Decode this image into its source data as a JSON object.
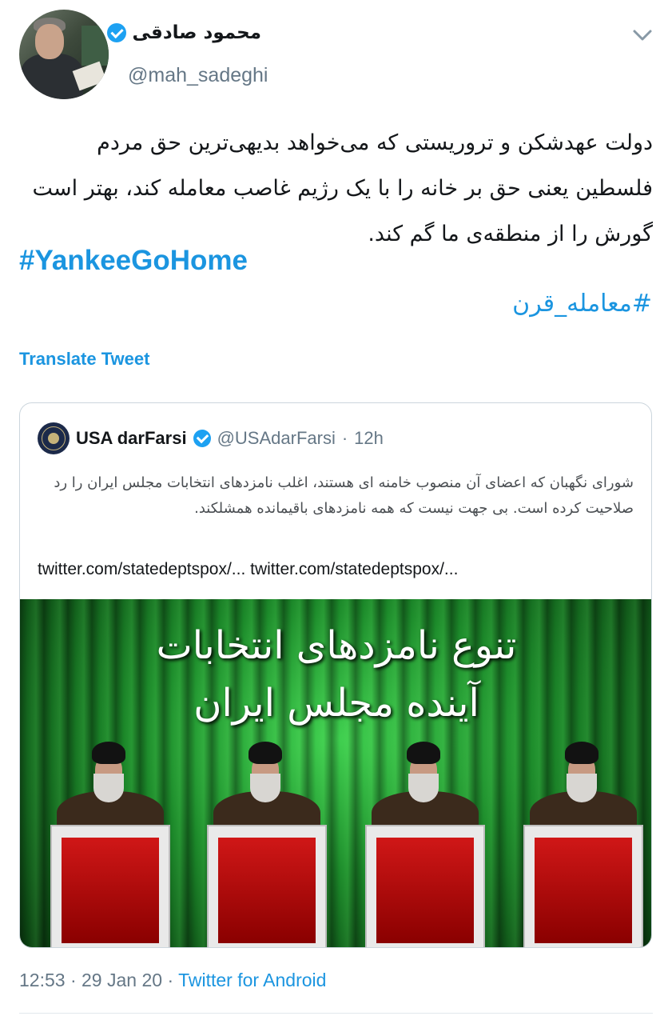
{
  "author": {
    "display_name": "محمود صادقی",
    "handle": "@mah_sadeghi",
    "verified": true
  },
  "tweet": {
    "text": "دولت عهدشکن و تروریستی که می‌خواهد بدیهی‌ترین حق مردم فلسطین یعنی حق بر خانه را با یک رژیم غاصب معامله کند، بهتر است گورش را از منطقه‌ی ما گم کند.",
    "hashtag_en": "#YankeeGoHome",
    "hashtag_fa": "#معامله_قرن",
    "translate_label": "Translate Tweet"
  },
  "quoted_tweet": {
    "name": "USA darFarsi",
    "handle": "@USAdarFarsi",
    "separator": "·",
    "time": "12h",
    "verified": true,
    "text": "شورای نگهبان که اعضای آن منصوب خامنه ای هستند، اغلب نامزدهای انتخابات مجلس ایران را رد صلاحیت کرده است. بی جهت نیست که همه نامزدهای باقیمانده همشلکند.",
    "links": [
      "twitter.com/statedeptspox/...",
      "twitter.com/statedeptspox/..."
    ],
    "image_text": {
      "line1": "تنوع نامزدهای انتخابات",
      "line2": "آینده مجلس ایران"
    }
  },
  "meta": {
    "time": "12:53",
    "sep1": "·",
    "date": "29 Jan 20",
    "sep2": "·",
    "source": "Twitter for Android"
  },
  "colors": {
    "link_blue": "#1b95e0",
    "verified_blue": "#1da1f2",
    "secondary_text": "#657786",
    "border": "#ccd6dd"
  },
  "icons": {
    "verified": "verified-badge-icon",
    "chevron": "chevron-down-icon",
    "quoted_avatar": "state-department-seal-icon"
  }
}
